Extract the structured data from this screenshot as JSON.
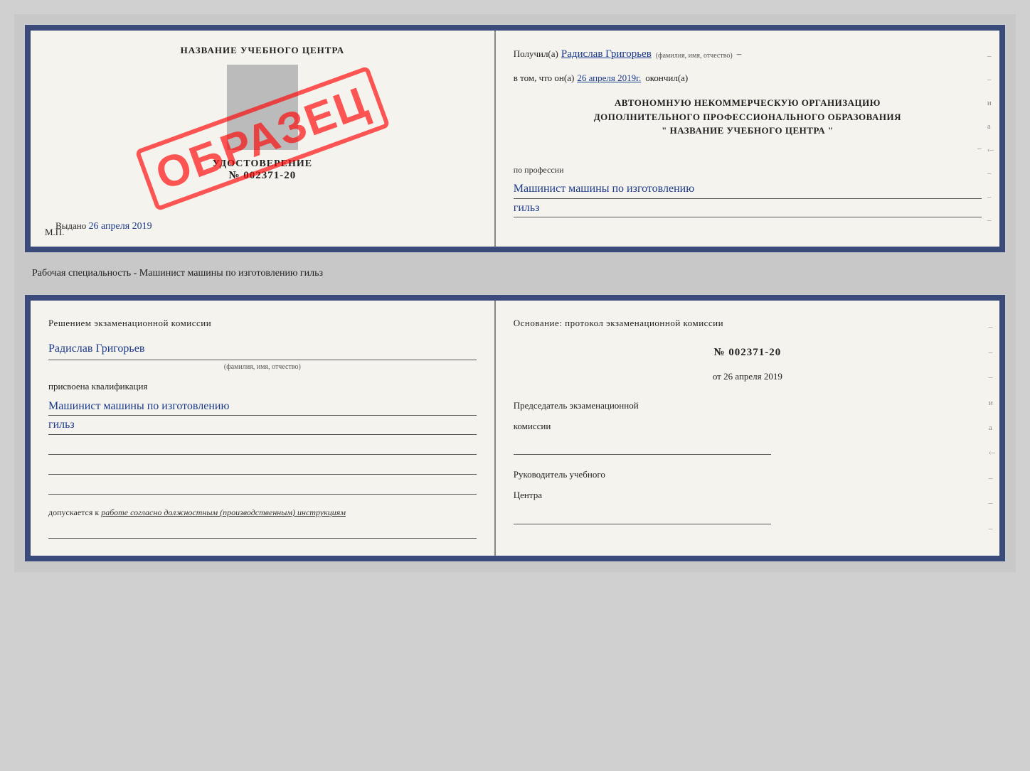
{
  "doc1": {
    "left": {
      "center_title": "НАЗВАНИЕ УЧЕБНОГО ЦЕНТРА",
      "ud_title": "УДОСТОВЕРЕНИЕ",
      "ud_number": "№ 002371-20",
      "vydano_label": "Выдано",
      "vydano_date": "26 апреля 2019",
      "mp_label": "М.П.",
      "stamp_text": "ОБРАЗЕЦ"
    },
    "right": {
      "poluchil_label": "Получил(а)",
      "poluchil_name": "Радислав Григорьев",
      "name_sub": "(фамилия, имя, отчество)",
      "dash1": "–",
      "vtom_label": "в том, что он(а)",
      "vtom_date": "26 апреля 2019г.",
      "okonchil_label": "окончил(а)",
      "block_line1": "АВТОНОМНУЮ НЕКОММЕРЧЕСКУЮ ОРГАНИЗАЦИЮ",
      "block_line2": "ДОПОЛНИТЕЛЬНОГО ПРОФЕССИОНАЛЬНОГО ОБРАЗОВАНИЯ",
      "block_line3": "\"  НАЗВАНИЕ УЧЕБНОГО ЦЕНТРА  \"",
      "dash2": "–",
      "po_professii_label": "по профессии",
      "profession_line1": "Машинист машины по изготовлению",
      "profession_line2": "гильз"
    }
  },
  "separator": {
    "text": "Рабочая специальность - Машинист машины по изготовлению гильз"
  },
  "doc2": {
    "left": {
      "komissia_title": "Решением  экзаменационной  комиссии",
      "name": "Радислав Григорьев",
      "name_sub": "(фамилия, имя, отчество)",
      "prisvoena_label": "присвоена квалификация",
      "qualification_line1": "Машинист машины по изготовлению",
      "qualification_line2": "гильз",
      "dopusk_label": "допускается к",
      "dopusk_text": "работе согласно должностным (производственным) инструкциям"
    },
    "right": {
      "osnование_label": "Основание:  протокол  экзаменационной  комиссии",
      "protocol_number": "№  002371-20",
      "protocol_date_prefix": "от",
      "protocol_date": "26 апреля 2019",
      "predsedatel_label": "Председатель экзаменационной",
      "komissia_label": "комиссии",
      "rukovoditel_label": "Руководитель учебного",
      "tsentra_label": "Центра"
    }
  }
}
